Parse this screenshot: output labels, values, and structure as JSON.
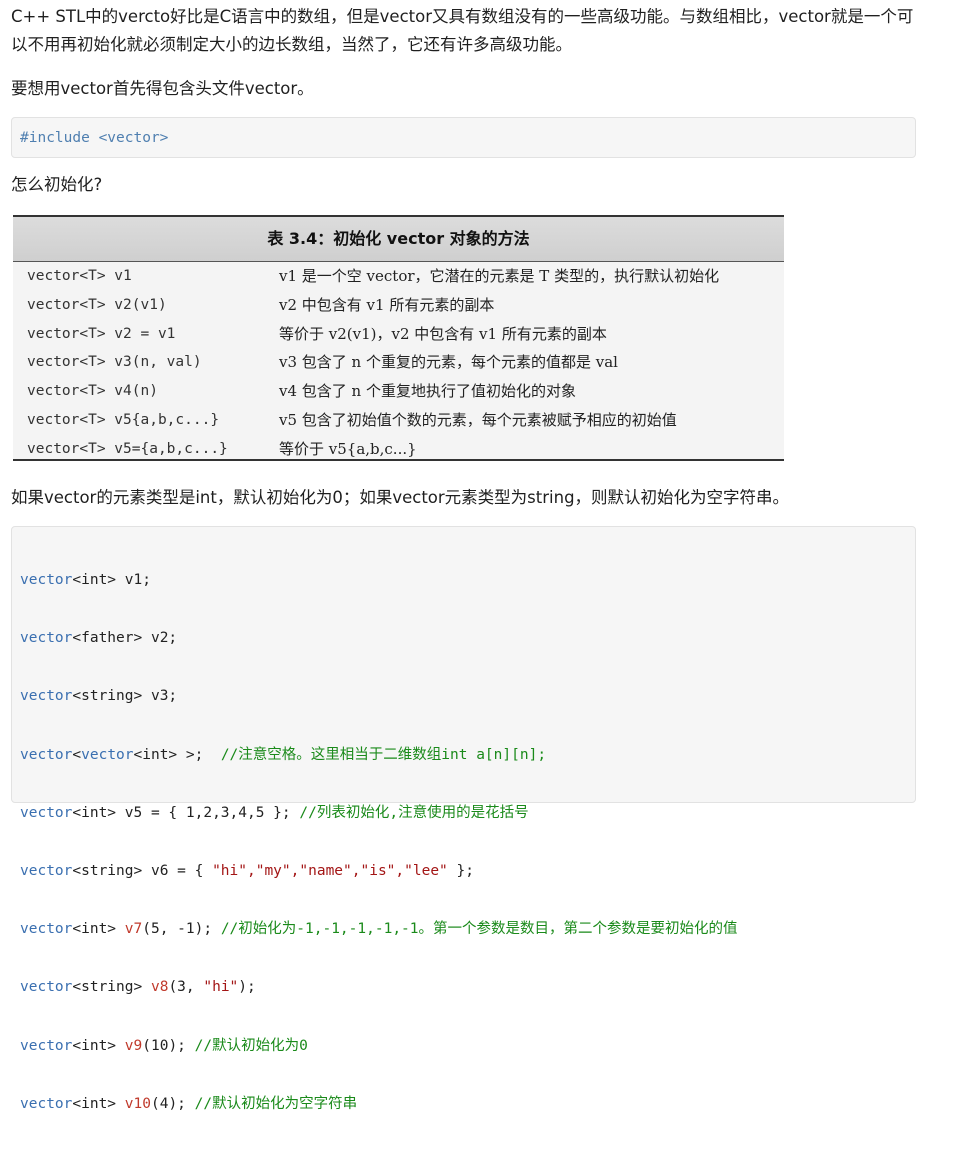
{
  "intro": "C++ STL中的vercto好比是C语言中的数组，但是vector又具有数组没有的一些高级功能。与数组相比，vector就是一个可以不用再初始化就必须制定大小的边长数组，当然了，它还有许多高级功能。",
  "header_note": "要想用vector首先得包含头文件vector。",
  "include_line": "#include <vector>",
  "init_question": "怎么初始化?",
  "table": {
    "title": "表 3.4：初始化 vector 对象的方法",
    "rows": [
      {
        "code": "vector<T> v1",
        "desc": "v1 是一个空 vector，它潜在的元素是 T 类型的，执行默认初始化"
      },
      {
        "code": "vector<T> v2(v1)",
        "desc": "v2 中包含有 v1 所有元素的副本"
      },
      {
        "code": "vector<T> v2 = v1",
        "desc": "等价于 v2(v1)，v2 中包含有 v1 所有元素的副本"
      },
      {
        "code": "vector<T> v3(n, val)",
        "desc": "v3 包含了 n 个重复的元素，每个元素的值都是 val"
      },
      {
        "code": "vector<T> v4(n)",
        "desc": "v4 包含了 n 个重复地执行了值初始化的对象"
      },
      {
        "code": "vector<T> v5{a,b,c...}",
        "desc": "v5 包含了初始值个数的元素，每个元素被赋予相应的初始值"
      },
      {
        "code": "vector<T> v5={a,b,c...}",
        "desc": "等价于 v5{a,b,c...}"
      }
    ]
  },
  "default_note": "如果vector的元素类型是int，默认初始化为0；如果vector元素类型为string，则默认初始化为空字符串。",
  "code": {
    "l1": {
      "kw": "vector",
      "rest": "<int> v1;"
    },
    "l2": {
      "kw": "vector",
      "rest": "<father> v2;"
    },
    "l3": {
      "kw": "vector",
      "rest": "<string> v3;"
    },
    "l4": {
      "kw1": "vector",
      "mid1": "<",
      "kw2": "vector",
      "mid2": "<int> >;  ",
      "comment": "//注意空格。这里相当于二维数组int a[n][n];"
    },
    "l5": {
      "kw": "vector",
      "rest": "<int> v5 = { 1,2,3,4,5 }; ",
      "comment": "//列表初始化,注意使用的是花括号"
    },
    "l6": {
      "kw": "vector",
      "rest1": "<string> v6 = { ",
      "strs": "\"hi\",\"my\",\"name\",\"is\",\"lee\"",
      "rest2": " };"
    },
    "l7": {
      "kw": "vector",
      "mid": "<int> ",
      "id": "v7",
      "args": "(5, -1); ",
      "comment": "//初始化为-1,-1,-1,-1,-1。第一个参数是数目，第二个参数是要初始化的值"
    },
    "l8": {
      "kw": "vector",
      "mid": "<string> ",
      "id": "v8",
      "args1": "(3, ",
      "str": "\"hi\"",
      "args2": ");"
    },
    "l9": {
      "kw": "vector",
      "mid": "<int> ",
      "id": "v9",
      "args": "(10); ",
      "comment": "//默认初始化为0"
    },
    "l10": {
      "kw": "vector",
      "mid": "<int> ",
      "id": "v10",
      "args": "(4); ",
      "comment": "//默认初始化为空字符串"
    }
  }
}
